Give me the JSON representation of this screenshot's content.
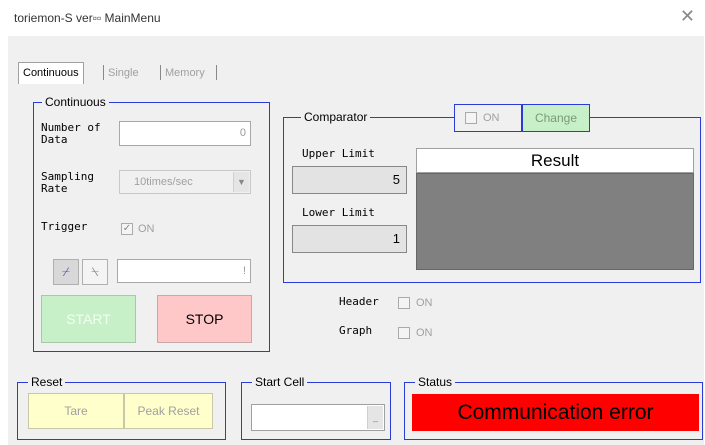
{
  "window": {
    "title": "toriemon-S ver▫▫ MainMenu",
    "close_icon": "close-icon"
  },
  "tabs": [
    {
      "label": "Continuous",
      "active": true
    },
    {
      "label": "Single",
      "active": false
    },
    {
      "label": "Memory",
      "active": false
    }
  ],
  "continuous": {
    "group_label": "Continuous",
    "number_of_data_label": "Number of\nData",
    "number_of_data_value": "0",
    "sampling_rate_label": "Sampling\nRate",
    "sampling_rate_value": "10times/sec",
    "trigger_label": "Trigger",
    "trigger_on_label": "ON",
    "trigger_checked": true,
    "edge_rise_icon": "rising-edge-icon",
    "edge_fall_icon": "falling-edge-icon",
    "trigger_value": "!",
    "start_label": "START",
    "stop_label": "STOP"
  },
  "comparator": {
    "group_label": "Comparator",
    "on_label": "ON",
    "change_label": "Change",
    "upper_limit_label": "Upper Limit",
    "upper_limit_value": "5",
    "lower_limit_label": "Lower Limit",
    "lower_limit_value": "1",
    "result_label": "Result"
  },
  "options": {
    "header_label": "Header",
    "header_on_label": "ON",
    "graph_label": "Graph",
    "graph_on_label": "ON"
  },
  "reset": {
    "group_label": "Reset",
    "tare_label": "Tare",
    "peak_reset_label": "Peak Reset"
  },
  "start_cell": {
    "group_label": "Start Cell",
    "value": ""
  },
  "status": {
    "group_label": "Status",
    "text": "Communication error"
  },
  "colors": {
    "group_border": "#2b3bd9",
    "start_bg": "#c8f0c8",
    "stop_bg": "#ffc8c8",
    "reset_bg": "#ffffcc",
    "status_bg": "#ff0000",
    "result_bg": "#808080"
  }
}
